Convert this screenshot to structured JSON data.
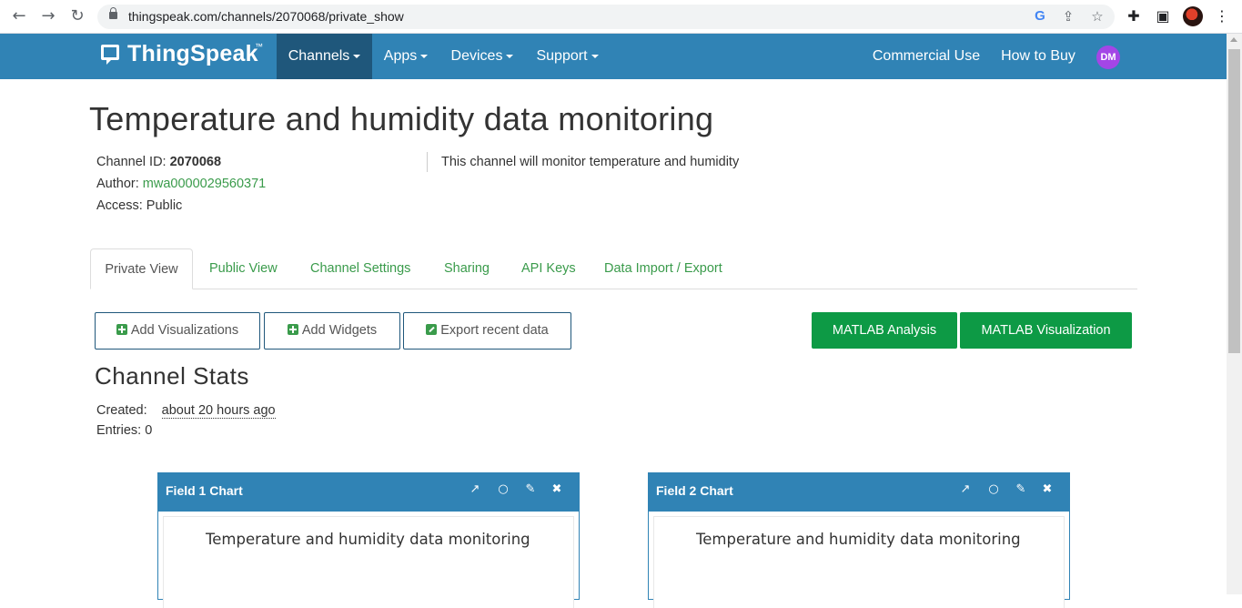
{
  "browser": {
    "url": "thingspeak.com/channels/2070068/private_show",
    "icons": [
      "back-icon",
      "forward-icon",
      "reload-icon",
      "lock-icon",
      "google-icon",
      "share-icon",
      "star-icon",
      "extensions-icon",
      "sidepanel-icon",
      "menu-icon"
    ]
  },
  "nav": {
    "logo": "ThingSpeak",
    "logo_tm": "™",
    "items": [
      {
        "label": "Channels"
      },
      {
        "label": "Apps"
      },
      {
        "label": "Devices"
      },
      {
        "label": "Support"
      }
    ],
    "commercial_use": "Commercial Use",
    "how_to_buy": "How to Buy",
    "avatar_initials": "DM",
    "colors": {
      "bar": "#3083b5",
      "active": "#1f577b",
      "avatar": "#a346e6"
    }
  },
  "channel": {
    "title": "Temperature and humidity data monitoring",
    "id_label": "Channel ID:",
    "id_value": "2070068",
    "author_label": "Author:",
    "author_value": "mwa0000029560371",
    "access_label": "Access:",
    "access_value": "Public",
    "description": "This channel will monitor temperature and humidity"
  },
  "tabs": [
    {
      "label": "Private View",
      "active": true
    },
    {
      "label": "Public View"
    },
    {
      "label": "Channel Settings"
    },
    {
      "label": "Sharing"
    },
    {
      "label": "API Keys"
    },
    {
      "label": "Data Import / Export"
    }
  ],
  "actions": {
    "add_visualizations": "Add Visualizations",
    "add_widgets": "Add Widgets",
    "export_recent_data": "Export recent data",
    "matlab_analysis": "MATLAB Analysis",
    "matlab_visualization": "MATLAB Visualization",
    "green": "#0d9a45"
  },
  "stats": {
    "heading": "Channel Stats",
    "created_label": "Created:",
    "created_value": "about 20 hours ago",
    "entries_label": "Entries:",
    "entries_value": "0"
  },
  "charts": [
    {
      "header": "Field 1 Chart",
      "title": "Temperature and humidity data monitoring"
    },
    {
      "header": "Field 2 Chart",
      "title": "Temperature and humidity data monitoring"
    }
  ],
  "chart_icons": [
    "external-link-icon",
    "comment-icon",
    "pencil-icon",
    "close-icon"
  ]
}
